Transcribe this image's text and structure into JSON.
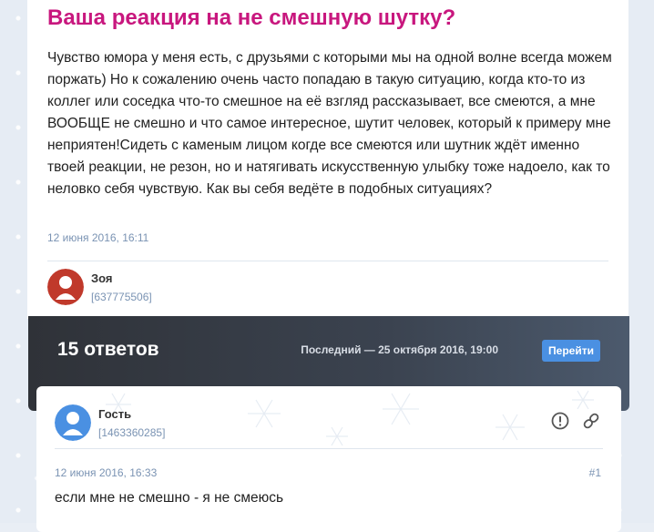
{
  "question": {
    "title": "Ваша реакция на не смешную шутку?",
    "body": "Чувство юмора у меня есть, с друзьями с которыми мы на одной волне всегда можем поржать) Но к сожалению очень часто попадаю в такую ситуацию, когда кто-то из коллег или соседка что-то смешное на её взгляд рассказывает, все смеются, а мне ВООБЩЕ не смешно и что самое интересное, шутит человек, который к примеру мне неприятен!Сидеть с каменым лицом когде все смеются или шутник ждёт именно твоей реакции, не резон, но и натягивать искусственную улыбку тоже надоело, как то неловко себя чувствую. Как вы себя ведёте в подобных ситуациях?",
    "date": "12 июня 2016, 16:11",
    "author": {
      "name": "Зоя",
      "id": "[637775506]",
      "avatar_color": "#c0392b"
    }
  },
  "answers_bar": {
    "count_label": "15 ответов",
    "last_label": "Последний — 25 октября 2016, 19:00",
    "go_label": "Перейти"
  },
  "answer": {
    "author": {
      "name": "Гость",
      "id": "[1463360285]",
      "avatar_color": "#4a90e2"
    },
    "date": "12 июня 2016, 16:33",
    "number": "#1",
    "text": "если мне не смешно - я не смеюсь",
    "icons": [
      "report-icon",
      "link-icon"
    ]
  },
  "colors": {
    "title": "#c8177e",
    "accent": "#4a90e2",
    "meta": "#7a93b3"
  }
}
